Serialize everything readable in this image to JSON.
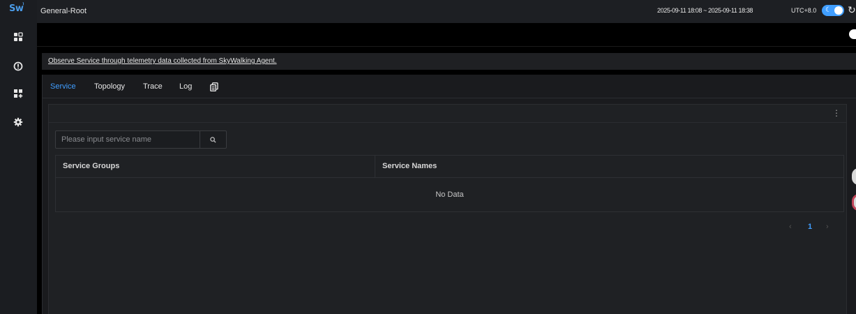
{
  "app": {
    "logo_text": "Sw",
    "title": "General-Root",
    "time_range": "2025-09-11 18:08 ~ 2025-09-11 18:38",
    "timezone": "UTC+8.0"
  },
  "sidebar": {
    "items": [
      {
        "icon": "dashboard-icon"
      },
      {
        "icon": "alert-icon"
      },
      {
        "icon": "add-widget-icon"
      },
      {
        "icon": "settings-icon"
      }
    ]
  },
  "description": {
    "text": "Observe Service through telemetry data collected from SkyWalking Agent."
  },
  "tabs": [
    {
      "label": "Service",
      "active": true
    },
    {
      "label": "Topology"
    },
    {
      "label": "Trace"
    },
    {
      "label": "Log"
    }
  ],
  "search": {
    "placeholder": "Please input service name",
    "value": ""
  },
  "table": {
    "columns": [
      "Service Groups",
      "Service Names"
    ],
    "rows": [],
    "empty_text": "No Data"
  },
  "pagination": {
    "current_page": "1",
    "prev": "‹",
    "next": "›"
  },
  "colors": {
    "accent": "#409eff",
    "background": "#000000"
  }
}
